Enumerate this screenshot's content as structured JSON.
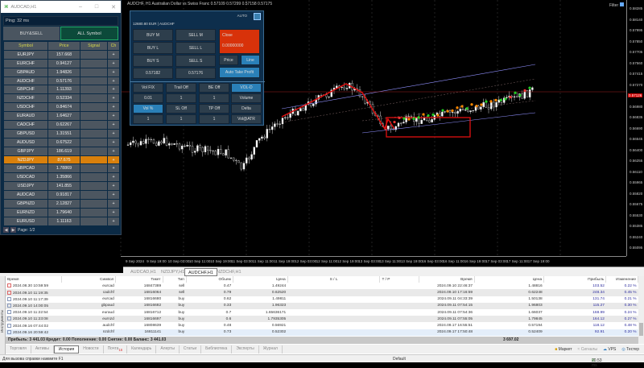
{
  "chart": {
    "title": "AUDCHF, H1  Australian Dollar vs Swiss Franc  0.57109 0.57299 0.57158 0.57175",
    "filter_label": "Filter",
    "price_labels": [
      "0.58285",
      "0.58140",
      "0.57995",
      "0.57850",
      "0.57705",
      "0.57560",
      "0.57415",
      "0.57270",
      "0.57126",
      "0.56980",
      "0.56835",
      "0.56690",
      "0.56545",
      "0.56400",
      "0.56255",
      "0.56110",
      "0.55965",
      "0.55820",
      "0.55675",
      "0.55530",
      "0.55385",
      "0.55240",
      "0.55095"
    ],
    "current_price": "0.57126",
    "time_labels": [
      "9 Sep 2024",
      "9 Sep 19:00",
      "10 Sep 03:00",
      "10 Sep 11:00",
      "10 Sep 19:00",
      "11 Sep 03:00",
      "11 Sep 11:00",
      "11 Sep 19:00",
      "12 Sep 03:00",
      "12 Sep 11:00",
      "12 Sep 19:00",
      "13 Sep 03:00",
      "13 Sep 11:00",
      "13 Sep 19:00",
      "16 Sep 03:00",
      "16 Sep 11:00",
      "16 Sep 19:00",
      "17 Sep 03:00",
      "17 Sep 11:00",
      "17 Sep 19:00"
    ],
    "colors": {
      "bull": "#ffffff",
      "bear": "#ffffff",
      "drawing": "#e01010",
      "channel": "#9090ff"
    }
  },
  "left_window": {
    "title": "AUDCAD,H1",
    "ping": "Ping: 32 ms",
    "buysell_label": "BUY&SELL",
    "all_symbol_label": "ALL Symbol",
    "columns": [
      "Symbol",
      "Price",
      "Signal",
      "Ch"
    ],
    "rows": [
      {
        "symbol": "EURJPY",
        "price": "157.668"
      },
      {
        "symbol": "EURCHF",
        "price": "0.94127"
      },
      {
        "symbol": "GBPAUD",
        "price": "1.94826"
      },
      {
        "symbol": "AUDCHF",
        "price": "0.57176"
      },
      {
        "symbol": "GBPCHF",
        "price": "1.11393"
      },
      {
        "symbol": "NZDCHF",
        "price": "0.52334"
      },
      {
        "symbol": "USDCHF",
        "price": "0.84674"
      },
      {
        "symbol": "EURAUD",
        "price": "1.64627"
      },
      {
        "symbol": "CADCHF",
        "price": "0.62267"
      },
      {
        "symbol": "GBPUSD",
        "price": "1.31551"
      },
      {
        "symbol": "AUDUSD",
        "price": "0.67522"
      },
      {
        "symbol": "GBPJPY",
        "price": "186.619"
      },
      {
        "symbol": "NZDJPY",
        "price": "87.675",
        "highlight": true
      },
      {
        "symbol": "GBPCAD",
        "price": "1.78869"
      },
      {
        "symbol": "USDCAD",
        "price": "1.35866"
      },
      {
        "symbol": "USDJPY",
        "price": "141.855"
      },
      {
        "symbol": "AUDCAD",
        "price": "0.91817"
      },
      {
        "symbol": "GBPNZD",
        "price": "2.12827"
      },
      {
        "symbol": "EURNZD",
        "price": "1.79640"
      },
      {
        "symbol": "EURUSD",
        "price": "1.11163"
      }
    ],
    "ch_symbol": "+",
    "page": "Page: 1/2"
  },
  "trade_panel": {
    "auto": "AUTO",
    "account": "12680.80 EUR | AUDCHF",
    "buy_m": "BUY M",
    "sell_m": "SELL M",
    "buy_l": "BUY L",
    "sell_l": "SELL L",
    "buy_s": "BUY S",
    "sell_s": "SELL S",
    "close": "Close",
    "close_value": "0.00000000",
    "price": "Price",
    "line": "Line",
    "bid": "0.57182",
    "ask": "0.57176",
    "auto_tp": "Auto Take Profit",
    "vol_fix": "Vol FIX",
    "trail_off": "Trail Off",
    "be_off": "BE Off",
    "vol_d": "VOL-D",
    "v001": "0.01",
    "v1a": "1",
    "v1b": "1",
    "volume": "Volume",
    "vol_pct": "Vol %",
    "sl_off": "SL Off",
    "tp_off": "TP Off",
    "delta": "Delta",
    "v1c": "1",
    "v1d": "1",
    "v1e": "1",
    "vol_atr": "Vol@ATR"
  },
  "chart_tabs": [
    "AUDCAD,H1",
    "NZDJPY,H1",
    "AUDCHF,H1",
    "NZDCHF,H1"
  ],
  "history": {
    "columns": [
      "Время",
      "Символ",
      "Тикет",
      "Тип",
      "Объем",
      "Цена",
      "S / L",
      "T / P",
      "Время",
      "Цена",
      "Прибыль",
      "Изменение"
    ],
    "rows": [
      {
        "open_time": "2024.08.30 10:59:59",
        "symbol": "eurcad",
        "ticket": "16847389",
        "type": "sell",
        "volume": "0.47",
        "price": "1.49244",
        "close_time": "2024.09.10 22:46:37",
        "close_price": "1.48816",
        "profit": "103.52",
        "change": "0.22 %"
      },
      {
        "open_time": "2024.09.10 11:19:35",
        "symbol": "cadchf",
        "ticket": "16816064",
        "type": "sell",
        "volume": "0.79",
        "price": "0.62520",
        "close_time": "2024.09.10 17:16:59",
        "close_price": "0.62248",
        "profit": "248.34",
        "change": "0.45 %"
      },
      {
        "open_time": "2024.09.10 11:17:39",
        "symbol": "eurcad",
        "ticket": "16816680",
        "type": "buy",
        "volume": "0.62",
        "price": "1.49811",
        "close_time": "2024.09.11 04:33:39",
        "close_price": "1.50138",
        "profit": "131.74",
        "change": "0.21 %"
      },
      {
        "open_time": "2024.09.10 14:00:05",
        "symbol": "gbpaud",
        "ticket": "16816682",
        "type": "buy",
        "volume": "0.33",
        "price": "1.96323",
        "close_time": "2024.09.11 07:54:15",
        "close_price": "1.96803",
        "profit": "115.27",
        "change": "0.30 %"
      },
      {
        "open_time": "2024.09.10 11:22:54",
        "symbol": "euraud",
        "ticket": "16816712",
        "type": "buy",
        "volume": "0.7",
        "price": "1.65636171",
        "close_time": "2024.09.11 07:54:36",
        "close_price": "1.66037",
        "profit": "168.99",
        "change": "0.24 %"
      },
      {
        "open_time": "2024.09.10 11:23:08",
        "symbol": "eurnzd",
        "ticket": "16816697",
        "type": "buy",
        "volume": "0.6",
        "price": "1.7935305",
        "close_time": "2024.09.11 07:55:05",
        "close_price": "1.79845",
        "profit": "164.12",
        "change": "0.27 %"
      },
      {
        "open_time": "2024.09.16 07:44:02",
        "symbol": "audchf",
        "ticket": "16808639",
        "type": "buy",
        "volume": "0.48",
        "price": "0.56921",
        "close_time": "2024.09.17 16:55:51",
        "close_price": "0.57194",
        "profit": "118.12",
        "change": "0.48 %"
      },
      {
        "open_time": "2024.09.16 20:59:42",
        "symbol": "nzdchf",
        "ticket": "16811141",
        "type": "buy",
        "volume": "0.73",
        "price": "0.52302",
        "close_time": "2024.09.17 17:50:48",
        "close_price": "0.52409",
        "profit": "92.91",
        "change": "0.20 %"
      }
    ],
    "summary": "Прибыль: 3 441.03  Кредит: 0.00  Пополнение: 0.00  Снятие: 0.00  Баланс: 3 441.03",
    "total": "3 697.02"
  },
  "side_label": "Инструменты",
  "bottom_tabs": [
    "Торговля",
    "Активы",
    "История",
    "Новости",
    "Почта",
    "Календарь",
    "Алерты",
    "Статьи",
    "Библиотека",
    "Эксперты",
    "Журнал"
  ],
  "mail_badge": "16",
  "tools": [
    "Маркет",
    "Сигналы",
    "VPS",
    "Тестер"
  ],
  "status": {
    "help": "Для вызова справки нажмите F1",
    "profile": "Default",
    "ping": "20.53 ms"
  }
}
